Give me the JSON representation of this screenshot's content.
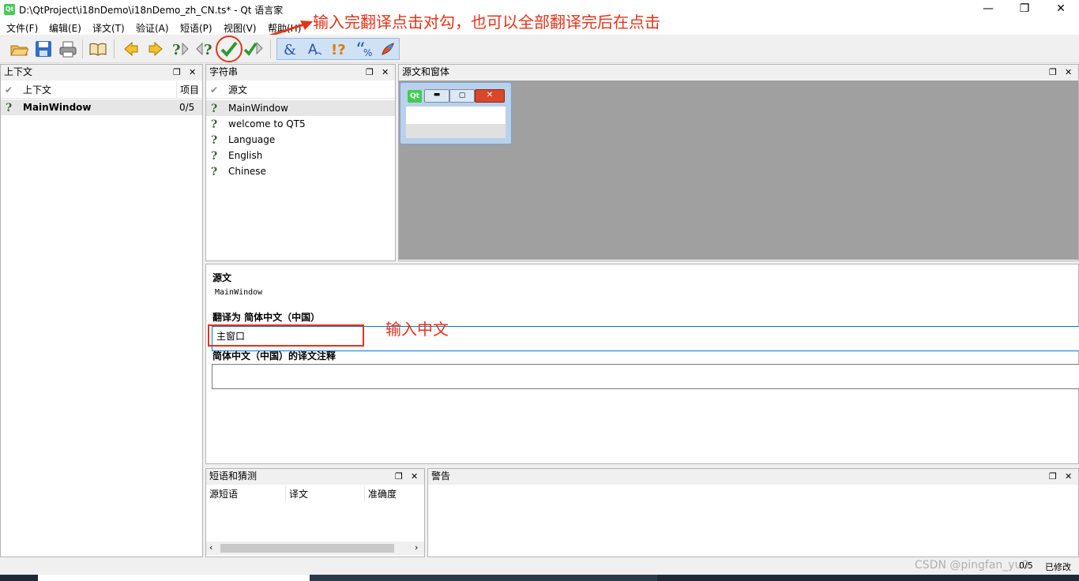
{
  "window": {
    "title": "D:\\QtProject\\i18nDemo\\i18nDemo_zh_CN.ts* - Qt 语言家",
    "minimize": "—",
    "maximize": "❐",
    "close": "✕"
  },
  "menu": [
    "文件(F)",
    "编辑(E)",
    "译文(T)",
    "验证(A)",
    "短语(P)",
    "视图(V)",
    "帮助(H)"
  ],
  "annotations": {
    "top": "输入完翻译点击对勾，也可以全部翻译完后在点击",
    "input": "输入中文"
  },
  "context_dock": {
    "title": "上下文",
    "col_context": "上下文",
    "col_items": "项目",
    "rows": [
      {
        "name": "MainWindow",
        "count": "0/5"
      }
    ]
  },
  "strings_dock": {
    "title": "字符串",
    "col_source": "源文",
    "rows": [
      "MainWindow",
      "welcome to QT5",
      "Language",
      "English",
      "Chinese"
    ]
  },
  "sources_dock": {
    "title": "源文和窗体"
  },
  "editor": {
    "source_label": "源文",
    "source_text": "MainWindow",
    "translation_label": "翻译为 简体中文（中国）",
    "translation_value": "主窗口",
    "comment_label": "简体中文（中国）的译文注释",
    "comment_value": ""
  },
  "phrases_dock": {
    "title": "短语和猜测",
    "cols": [
      "源短语",
      "译文",
      "准确度"
    ]
  },
  "warnings_dock": {
    "title": "警告"
  },
  "status": {
    "progress": "0/5",
    "modified": "已修改",
    "watermark": "CSDN @pingfan_yu0"
  },
  "colors": {
    "annotation": "#e53319",
    "selected_row": "#e6e6e6",
    "preview_bg": "#a0a0a0",
    "focus_border": "#0078d7"
  }
}
